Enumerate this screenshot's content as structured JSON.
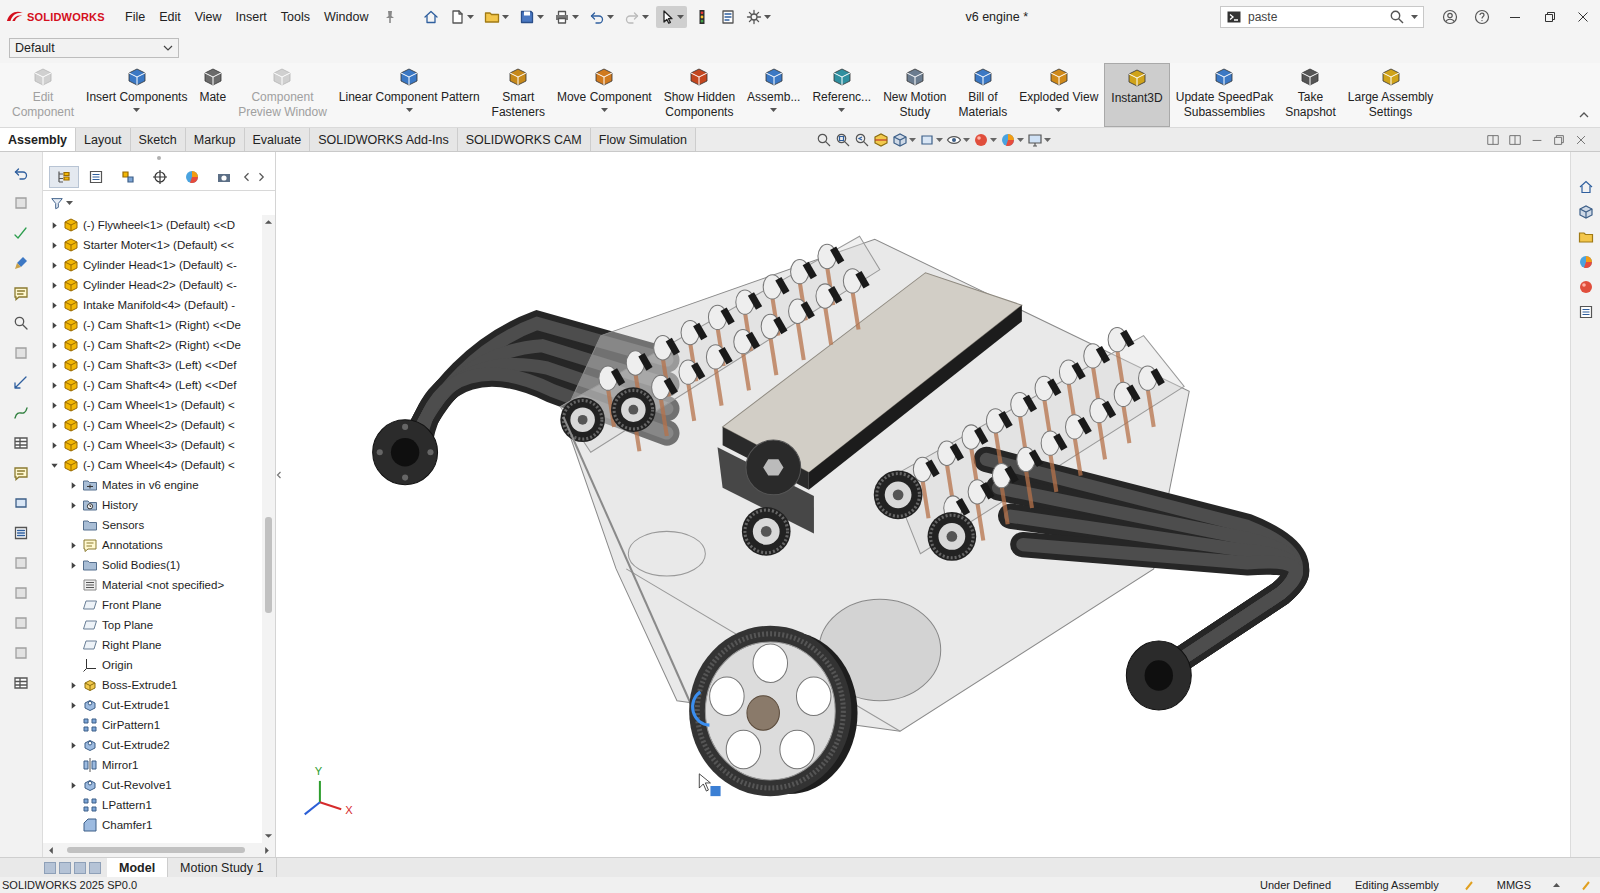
{
  "app": {
    "logo": "SOLIDWORKS",
    "title": "v6 engine *"
  },
  "menu": [
    "File",
    "Edit",
    "View",
    "Insert",
    "Tools",
    "Window"
  ],
  "quick_tools": [
    {
      "selected": false,
      "disabled": false
    },
    {
      "selected": false,
      "disabled": false
    },
    {
      "selected": false,
      "disabled": false
    },
    {
      "selected": false,
      "disabled": false
    },
    {
      "selected": false,
      "disabled": false
    },
    {
      "selected": false,
      "disabled": false
    },
    {
      "selected": false,
      "disabled": true
    },
    {
      "selected": true,
      "disabled": false
    },
    {
      "selected": false,
      "disabled": false
    },
    {
      "selected": false,
      "disabled": false
    },
    {
      "selected": false,
      "disabled": false
    }
  ],
  "search": {
    "value": "paste"
  },
  "config": {
    "value": "Default"
  },
  "ribbon": [
    {
      "lines": [
        "Edit",
        "Component"
      ],
      "disabled": true,
      "selected": false,
      "dropdown": false
    },
    {
      "lines": [
        "Insert Components"
      ],
      "disabled": false,
      "selected": false,
      "dropdown": true
    },
    {
      "lines": [
        "Mate"
      ],
      "disabled": false,
      "selected": false,
      "dropdown": false
    },
    {
      "lines": [
        "Component",
        "Preview Window"
      ],
      "disabled": true,
      "selected": false,
      "dropdown": false
    },
    {
      "lines": [
        "Linear Component Pattern"
      ],
      "disabled": false,
      "selected": false,
      "dropdown": true
    },
    {
      "lines": [
        "Smart",
        "Fasteners"
      ],
      "disabled": false,
      "selected": false,
      "dropdown": false
    },
    {
      "lines": [
        "Move Component"
      ],
      "disabled": false,
      "selected": false,
      "dropdown": true
    },
    {
      "lines": [
        "Show Hidden",
        "Components"
      ],
      "disabled": false,
      "selected": false,
      "dropdown": false
    },
    {
      "lines": [
        "Assemb..."
      ],
      "disabled": false,
      "selected": false,
      "dropdown": true
    },
    {
      "lines": [
        "Referenc..."
      ],
      "disabled": false,
      "selected": false,
      "dropdown": true
    },
    {
      "lines": [
        "New Motion",
        "Study"
      ],
      "disabled": false,
      "selected": false,
      "dropdown": false
    },
    {
      "lines": [
        "Bill of",
        "Materials"
      ],
      "disabled": false,
      "selected": false,
      "dropdown": false
    },
    {
      "lines": [
        "Exploded View"
      ],
      "disabled": false,
      "selected": false,
      "dropdown": true
    },
    {
      "lines": [
        "Instant3D"
      ],
      "disabled": false,
      "selected": true,
      "dropdown": false
    },
    {
      "lines": [
        "Update SpeedPak",
        "Subassemblies"
      ],
      "disabled": false,
      "selected": false,
      "dropdown": false
    },
    {
      "lines": [
        "Take",
        "Snapshot"
      ],
      "disabled": false,
      "selected": false,
      "dropdown": false
    },
    {
      "lines": [
        "Large Assembly",
        "Settings"
      ],
      "disabled": false,
      "selected": false,
      "dropdown": false
    }
  ],
  "tabs": [
    {
      "label": "Assembly",
      "selected": true
    },
    {
      "label": "Layout",
      "selected": false
    },
    {
      "label": "Sketch",
      "selected": false
    },
    {
      "label": "Markup",
      "selected": false
    },
    {
      "label": "Evaluate",
      "selected": false
    },
    {
      "label": "SOLIDWORKS Add-Ins",
      "selected": false
    },
    {
      "label": "SOLIDWORKS CAM",
      "selected": false
    },
    {
      "label": "Flow Simulation",
      "selected": false
    }
  ],
  "tree_tabs": [
    {
      "selected": true
    },
    {
      "selected": false
    },
    {
      "selected": false
    },
    {
      "selected": false
    },
    {
      "selected": false
    },
    {
      "selected": false
    }
  ],
  "tree": [
    {
      "label": "(-) Flywheel<1> (Default) <<D",
      "kind": "component",
      "expandable": true,
      "expanded": false
    },
    {
      "label": "Starter Moter<1> (Default) <<",
      "kind": "component",
      "expandable": true,
      "expanded": false
    },
    {
      "label": "Cylinder Head<1> (Default) <-",
      "kind": "component",
      "expandable": true,
      "expanded": false
    },
    {
      "label": "Cylinder Head<2> (Default) <-",
      "kind": "component",
      "expandable": true,
      "expanded": false
    },
    {
      "label": "Intake Manifold<4> (Default) -",
      "kind": "component",
      "expandable": true,
      "expanded": false
    },
    {
      "label": "(-) Cam Shaft<1> (Right) <<De",
      "kind": "component",
      "expandable": true,
      "expanded": false
    },
    {
      "label": "(-) Cam Shaft<2> (Right) <<De",
      "kind": "component",
      "expandable": true,
      "expanded": false
    },
    {
      "label": "(-) Cam Shaft<3> (Left) <<Def",
      "kind": "component",
      "expandable": true,
      "expanded": false
    },
    {
      "label": "(-) Cam Shaft<4> (Left) <<Def",
      "kind": "component",
      "expandable": true,
      "expanded": false
    },
    {
      "label": "(-) Cam Wheel<1> (Default) <",
      "kind": "component",
      "expandable": true,
      "expanded": false
    },
    {
      "label": "(-) Cam Wheel<2> (Default) <",
      "kind": "component",
      "expandable": true,
      "expanded": false
    },
    {
      "label": "(-) Cam Wheel<3> (Default) <",
      "kind": "component",
      "expandable": true,
      "expanded": false
    },
    {
      "label": "(-) Cam Wheel<4> (Default) <",
      "kind": "component",
      "expandable": true,
      "expanded": true,
      "children": [
        {
          "label": "Mates in v6 engine",
          "kind": "mates",
          "expandable": true,
          "expanded": false
        },
        {
          "label": "History",
          "kind": "history",
          "expandable": true,
          "expanded": false
        },
        {
          "label": "Sensors",
          "kind": "folder",
          "expandable": false,
          "expanded": false
        },
        {
          "label": "Annotations",
          "kind": "note",
          "expandable": true,
          "expanded": false
        },
        {
          "label": "Solid Bodies(1)",
          "kind": "folder",
          "expandable": true,
          "expanded": false
        },
        {
          "label": "Material <not specified>",
          "kind": "material",
          "expandable": false,
          "expanded": false
        },
        {
          "label": "Front Plane",
          "kind": "plane",
          "expandable": false,
          "expanded": false
        },
        {
          "label": "Top Plane",
          "kind": "plane",
          "expandable": false,
          "expanded": false
        },
        {
          "label": "Right Plane",
          "kind": "plane",
          "expandable": false,
          "expanded": false
        },
        {
          "label": "Origin",
          "kind": "origin",
          "expandable": false,
          "expanded": false
        },
        {
          "label": "Boss-Extrude1",
          "kind": "feature",
          "expandable": true,
          "expanded": false
        },
        {
          "label": "Cut-Extrude1",
          "kind": "cut",
          "expandable": true,
          "expanded": false
        },
        {
          "label": "CirPattern1",
          "kind": "pattern",
          "expandable": false,
          "expanded": false
        },
        {
          "label": "Cut-Extrude2",
          "kind": "cut",
          "expandable": true,
          "expanded": false
        },
        {
          "label": "Mirror1",
          "kind": "mirror",
          "expandable": false,
          "expanded": false
        },
        {
          "label": "Cut-Revolve1",
          "kind": "cut",
          "expandable": true,
          "expanded": false
        },
        {
          "label": "LPattern1",
          "kind": "pattern",
          "expandable": false,
          "expanded": false
        },
        {
          "label": "Chamfer1",
          "kind": "chamfer",
          "expandable": false,
          "expanded": false
        }
      ]
    }
  ],
  "viewport": {
    "axes": [
      {
        "label": "Y",
        "color": "#2e9e2e"
      },
      {
        "label": "X",
        "color": "#d62b2b"
      }
    ]
  },
  "bottom_tabs": [
    {
      "label": "Model",
      "selected": true
    },
    {
      "label": "Motion Study 1",
      "selected": false
    }
  ],
  "status_bar": {
    "version": "SOLIDWORKS 2025 SP0.0",
    "items": [
      "Under Defined",
      "Editing Assembly",
      "MMGS"
    ]
  }
}
